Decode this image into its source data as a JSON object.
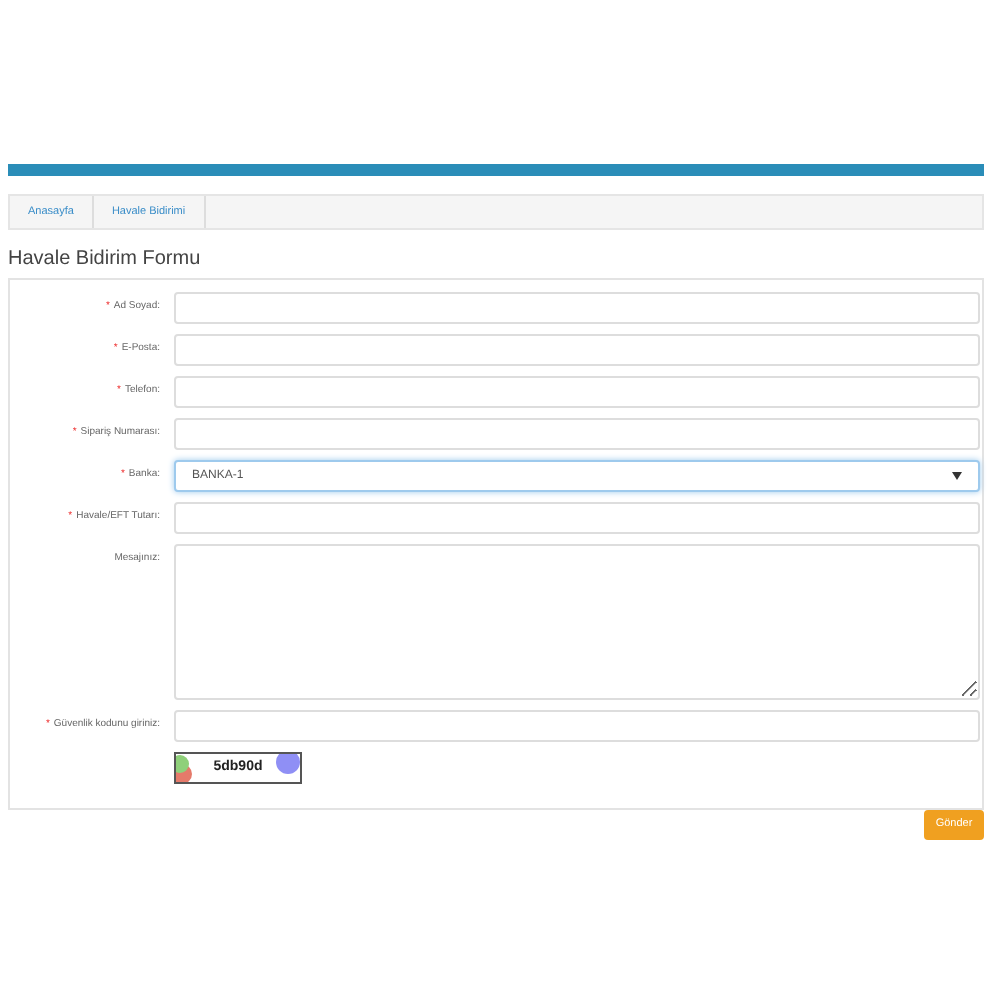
{
  "breadcrumb": [
    {
      "label": "Anasayfa"
    },
    {
      "label": "Havale Bidirimi"
    }
  ],
  "title": "Havale Bidirim Formu",
  "fields": [
    {
      "mark": "*",
      "label": "Ad Soyad:",
      "kind": "text"
    },
    {
      "mark": "*",
      "label": "E-Posta:",
      "kind": "text"
    },
    {
      "mark": "*",
      "label": "Telefon:",
      "kind": "text"
    },
    {
      "mark": "*",
      "label": "Sipariş Numarası:",
      "kind": "text"
    },
    {
      "mark": "*",
      "label": "Banka:",
      "kind": "select",
      "value": "BANKA-1",
      "focused": true
    },
    {
      "mark": "*",
      "label": "Havale/EFT Tutarı:",
      "kind": "text"
    },
    {
      "label": "Mesajınız:",
      "kind": "textarea"
    },
    {
      "mark": "*",
      "label": "Güvenlik kodunu giriniz:",
      "kind": "text"
    }
  ],
  "captcha": {
    "code": "5db90d"
  },
  "submit": "Gönder"
}
